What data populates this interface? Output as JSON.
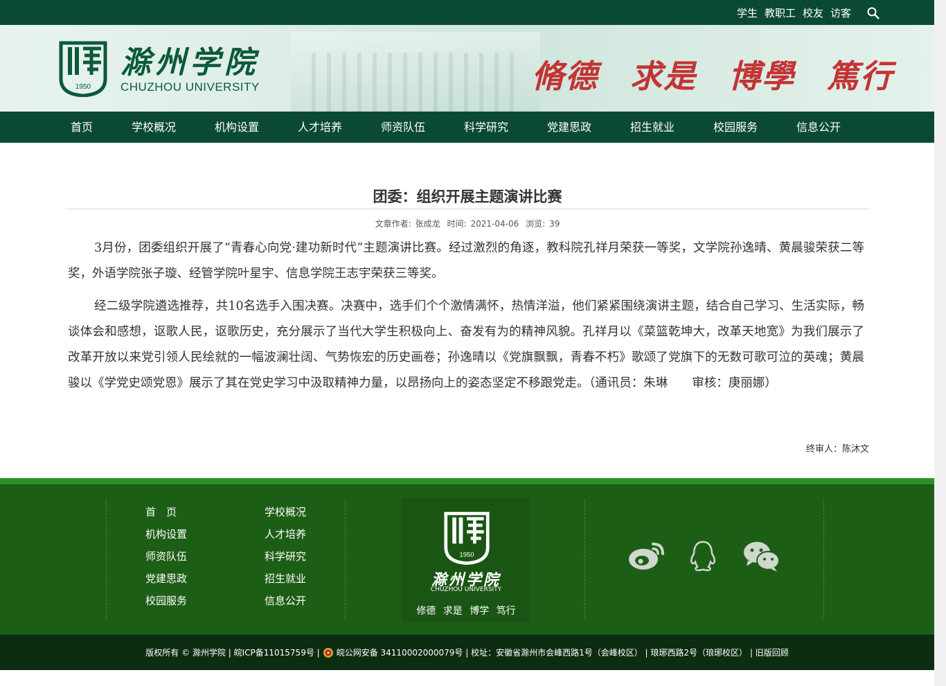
{
  "topbar": {
    "links": [
      "学生",
      "教职工",
      "校友",
      "访客"
    ],
    "search_icon": "search-icon"
  },
  "header": {
    "school_name_cn": "滁州学院",
    "school_name_en": "CHUZHOU UNIVERSITY",
    "emblem_year": "1950",
    "motto": [
      "脩德",
      "求是",
      "博學",
      "篤行"
    ]
  },
  "nav": [
    "首页",
    "学校概况",
    "机构设置",
    "人才培养",
    "师资队伍",
    "科学研究",
    "党建思政",
    "招生就业",
    "校园服务",
    "信息公开"
  ],
  "article": {
    "title": "团委：组织开展主题演讲比赛",
    "author_label": "文章作者:",
    "author": "张成龙",
    "time_label": "时间:",
    "time": "2021-04-06",
    "views_label": "浏览:",
    "views": "39",
    "paragraphs": [
      "3月份，团委组织开展了“青春心向党·建功新时代”主题演讲比赛。经过激烈的角逐，教科院孔祥月荣获一等奖，文学院孙逸晴、黄晨骏荣获二等奖，外语学院张子璇、经管学院叶星宇、信息学院王志宇荣获三等奖。",
      "经二级学院遴选推荐，共10名选手入围决赛。决赛中，选手们个个激情满怀，热情洋溢，他们紧紧围绕演讲主题，结合自己学习、生活实际，畅谈体会和感想，讴歌人民，讴歌历史，充分展示了当代大学生积极向上、奋发有为的精神风貌。孔祥月以《菜篮乾坤大，改革天地宽》为我们展示了改革开放以来党引领人民绘就的一幅波澜壮阔、气势恢宏的历史画卷；孙逸晴以《党旗飘飘，青春不朽》歌颂了党旗下的无数可歌可泣的英魂；黄晨骏以《学党史颂党恩》展示了其在党史学习中汲取精神力量，以昂扬向上的姿态坚定不移跟党走。（通讯员：朱琳　　审核：庚丽娜）"
    ],
    "reviewer": "终审人：陈沐文"
  },
  "footer": {
    "links_col1": [
      "首　页",
      "机构设置",
      "师资队伍",
      "党建思政",
      "校园服务"
    ],
    "links_col2": [
      "学校概况",
      "人才培养",
      "科学研究",
      "招生就业",
      "信息公开"
    ],
    "logo_cn": "滁州学院",
    "logo_en": "CHUZHOU UNIVERSITY",
    "logo_year": "1950",
    "motto": "修德 求是 博学 笃行",
    "social_icons": [
      "weibo-icon",
      "qq-icon",
      "wechat-icon"
    ],
    "copyright_left": "版权所有 © 滁州学院 | 皖ICP备11015759号 |",
    "copyright_right": "皖公网安备 34110002000079号 | 校址：安徽省滁州市会峰西路1号（会峰校区） | 琅琊西路2号（琅琊校区） | 旧版回顾"
  },
  "colors": {
    "nav_green": "#0b4a32",
    "footer_green": "#1d5e16",
    "motto_red": "#c23434"
  }
}
